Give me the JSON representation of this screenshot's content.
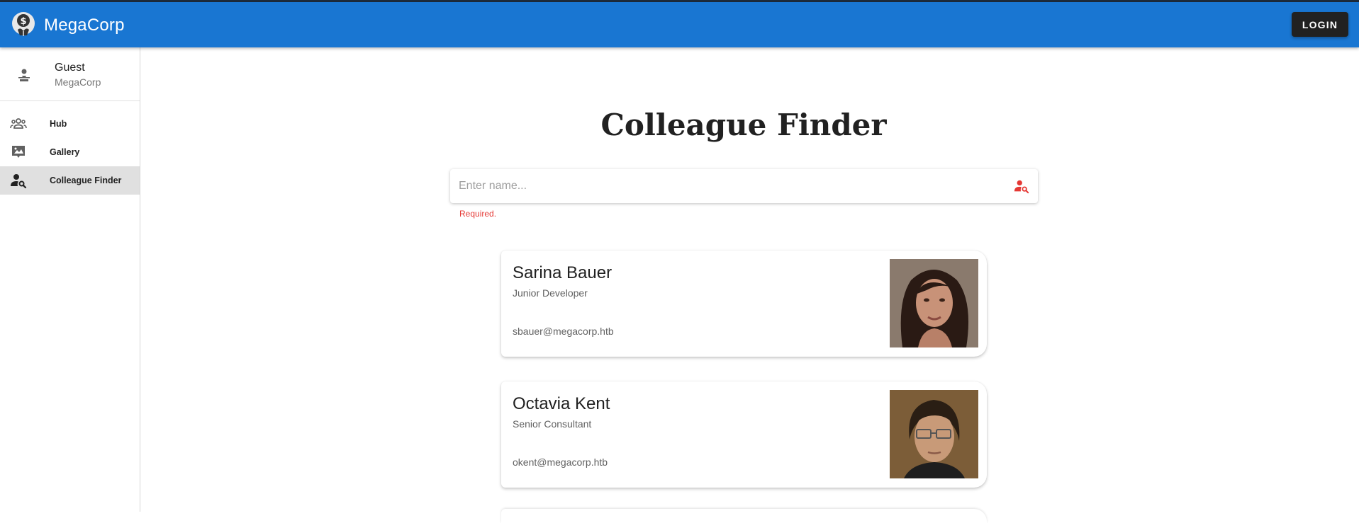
{
  "app": {
    "title": "MegaCorp",
    "accent": "#1976d2",
    "login_label": "LOGIN"
  },
  "user": {
    "name": "Guest",
    "org": "MegaCorp"
  },
  "sidebar": {
    "items": [
      {
        "label": "Hub",
        "icon": "people-icon",
        "active": false
      },
      {
        "label": "Gallery",
        "icon": "gallery-icon",
        "active": false
      },
      {
        "label": "Colleague Finder",
        "icon": "person-search-icon",
        "active": true
      }
    ]
  },
  "main": {
    "title": "Colleague Finder",
    "search": {
      "placeholder": "Enter name...",
      "value": "",
      "error": "Required."
    },
    "colleagues": [
      {
        "name": "Sarina Bauer",
        "role": "Junior Developer",
        "email": "sbauer@megacorp.htb"
      },
      {
        "name": "Octavia Kent",
        "role": "Senior Consultant",
        "email": "okent@megacorp.htb"
      }
    ]
  },
  "colors": {
    "error": "#e53935",
    "search_icon": "#e53935",
    "login_bg": "#212121"
  }
}
